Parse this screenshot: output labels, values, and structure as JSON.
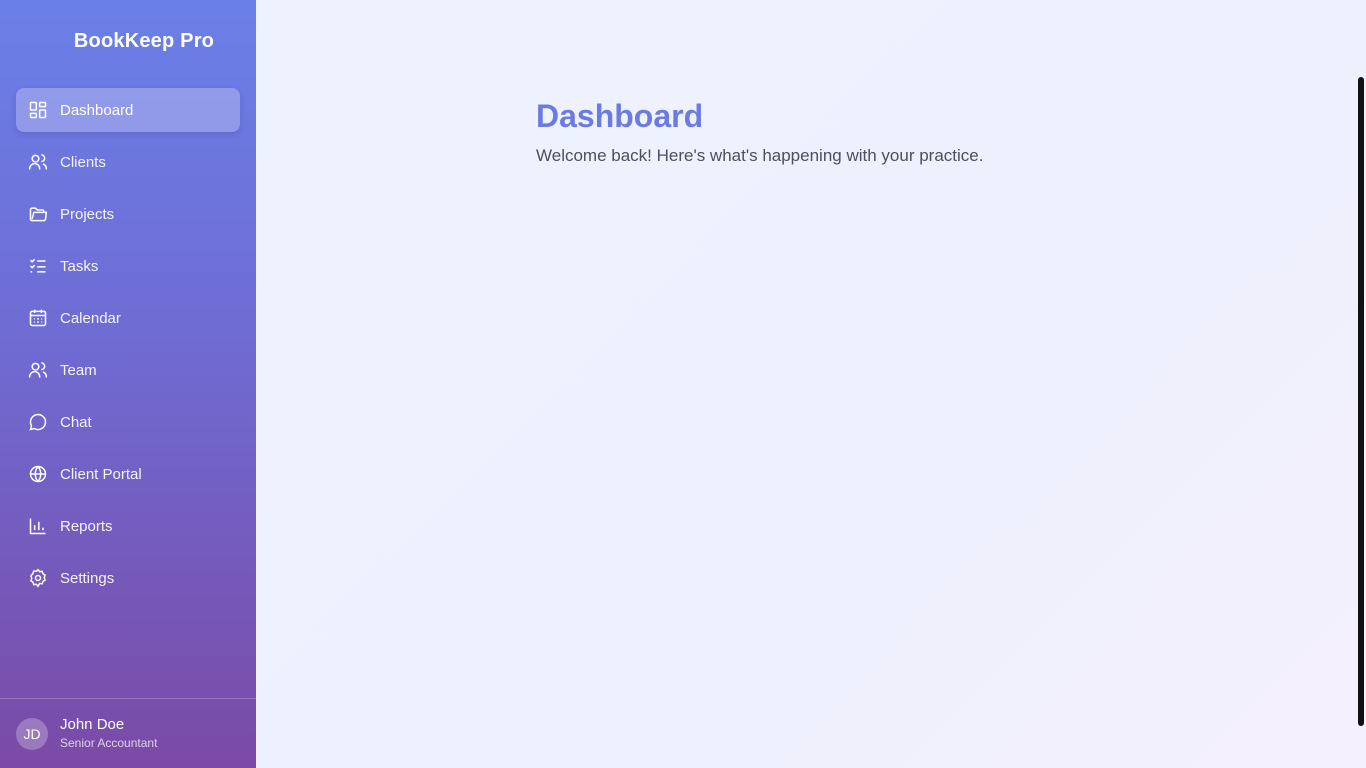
{
  "app": {
    "title": "BookKeep Pro"
  },
  "sidebar": {
    "items": [
      {
        "label": "Dashboard",
        "icon": "dashboard-icon",
        "active": true
      },
      {
        "label": "Clients",
        "icon": "users-icon"
      },
      {
        "label": "Projects",
        "icon": "folder-icon"
      },
      {
        "label": "Tasks",
        "icon": "checklist-icon"
      },
      {
        "label": "Calendar",
        "icon": "calendar-icon"
      },
      {
        "label": "Team",
        "icon": "team-icon"
      },
      {
        "label": "Chat",
        "icon": "chat-icon"
      },
      {
        "label": "Client Portal",
        "icon": "globe-icon"
      },
      {
        "label": "Reports",
        "icon": "bar-chart-icon"
      },
      {
        "label": "Settings",
        "icon": "gear-icon"
      }
    ]
  },
  "user": {
    "initials": "JD",
    "name": "John Doe",
    "role": "Senior Accountant"
  },
  "main": {
    "title": "Dashboard",
    "subtitle": "Welcome back! Here's what's happening with your practice."
  },
  "colors": {
    "accent": "#6c7bdf",
    "sidebar_top": "#6a80e8",
    "sidebar_bottom": "#7a4aa6"
  }
}
